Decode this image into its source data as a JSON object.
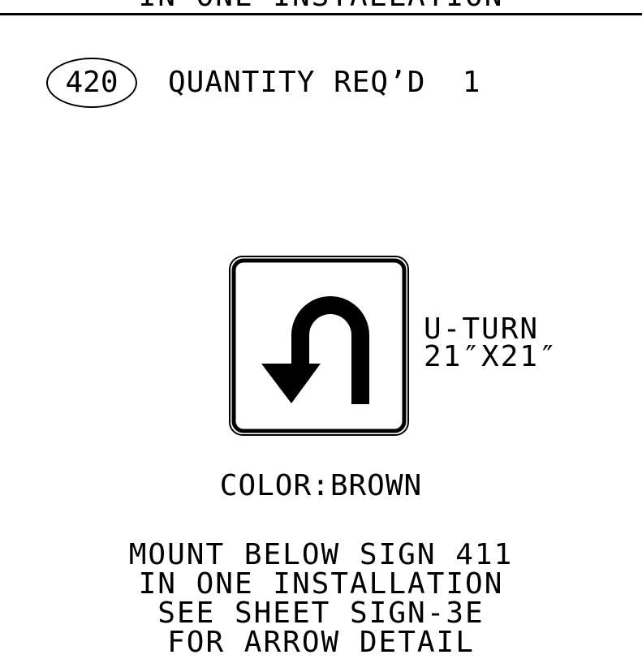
{
  "header": {
    "title": "IN ONE INSTALLATION"
  },
  "sign": {
    "number": "420",
    "quantity_label": "QUANTITY REQ’D  1",
    "name": "U-TURN",
    "size": "21″X21″",
    "icon": "u-turn-left-arrow-icon",
    "color_note": "COLOR:BROWN"
  },
  "notes": {
    "lines": [
      "MOUNT BELOW SIGN 411",
      "IN ONE INSTALLATION",
      "SEE SHEET SIGN-3E",
      "FOR ARROW DETAIL"
    ]
  },
  "colors": {
    "ink": "#000000",
    "background": "#ffffff"
  }
}
